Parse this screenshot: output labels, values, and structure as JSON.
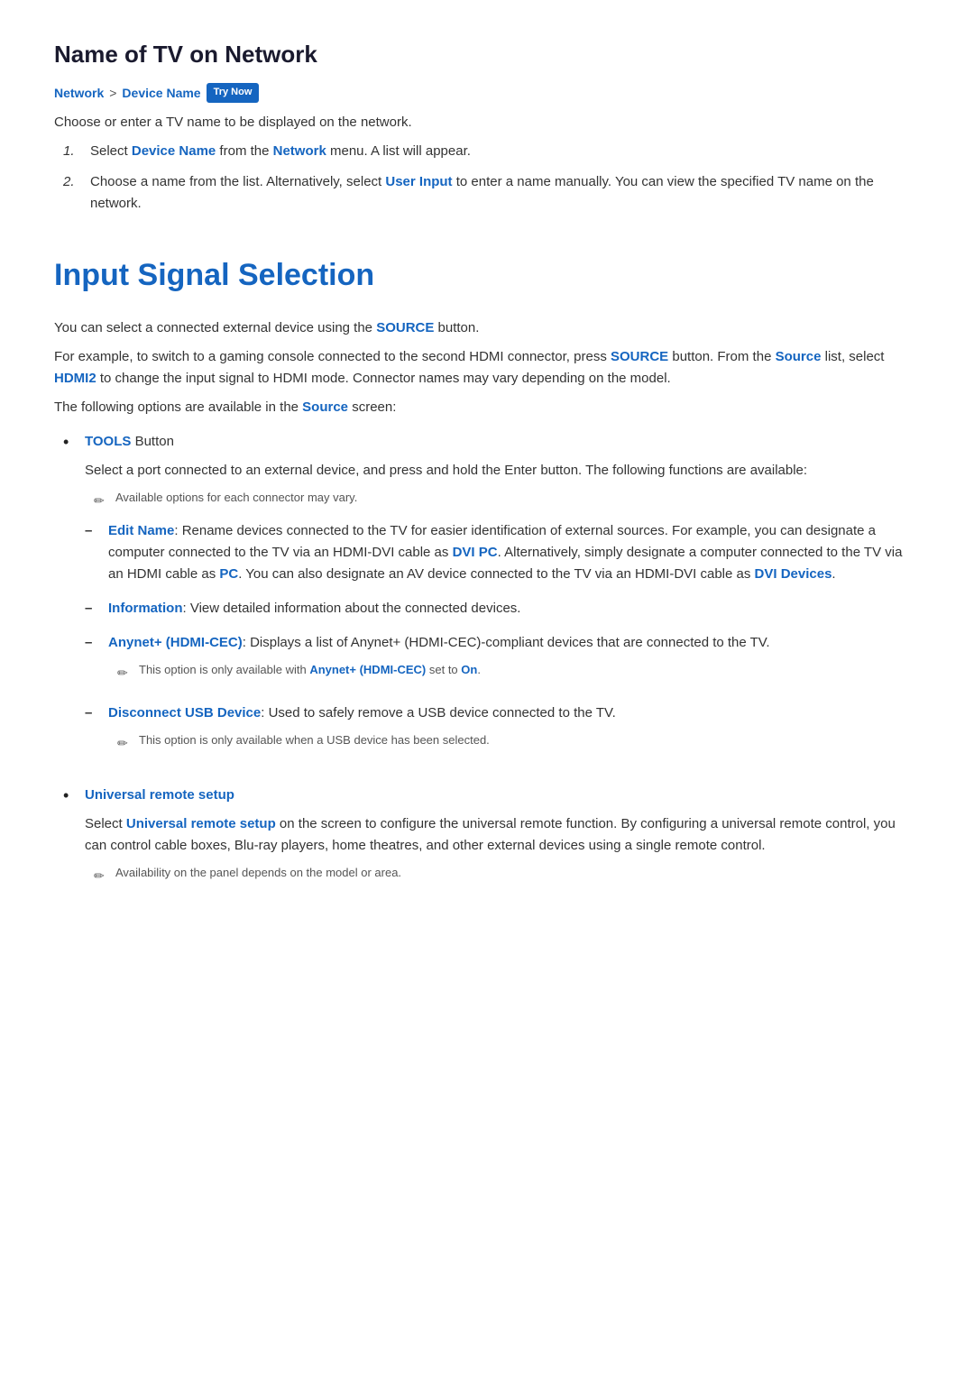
{
  "section1": {
    "title": "Name of TV on Network",
    "breadcrumb": {
      "part1": "Network",
      "separator": ">",
      "part2": "Device Name",
      "badge": "Try Now"
    },
    "intro": "Choose or enter a TV name to be displayed on the network.",
    "steps": [
      {
        "num": "1.",
        "text_before": "Select ",
        "highlight1": "Device Name",
        "text_mid": " from the ",
        "highlight2": "Network",
        "text_after": " menu. A list will appear."
      },
      {
        "num": "2.",
        "text_before": "Choose a name from the list. Alternatively, select ",
        "highlight1": "User Input",
        "text_after": " to enter a name manually. You can view the specified TV name on the network."
      }
    ]
  },
  "section2": {
    "title": "Input Signal Selection",
    "intro1_before": "You can select a connected external device using the ",
    "intro1_highlight": "SOURCE",
    "intro1_after": " button.",
    "intro2_before": "For example, to switch to a gaming console connected to the second HDMI connector, press ",
    "intro2_highlight1": "SOURCE",
    "intro2_mid1": " button. From the ",
    "intro2_highlight2": "Source",
    "intro2_mid2": " list, select ",
    "intro2_highlight3": "HDMI2",
    "intro2_after": " to change the input signal to HDMI mode. Connector names may vary depending on the model.",
    "intro3_before": "The following options are available in the ",
    "intro3_highlight": "Source",
    "intro3_after": " screen:",
    "bullets": [
      {
        "title": "TOOLS",
        "title_after": " Button",
        "description": "Select a port connected to an external device, and press and hold the Enter button. The following functions are available:",
        "note": "Available options for each connector may vary.",
        "sub_items": [
          {
            "title": "Edit Name",
            "title_suffix": ": Rename devices connected to the TV for easier identification of external sources. For example, you can designate a computer connected to the TV via an HDMI-DVI cable as ",
            "highlight1": "DVI PC",
            "mid1": ". Alternatively, simply designate a computer connected to the TV via an HDMI cable as ",
            "highlight2": "PC",
            "mid2": ". You can also designate an AV device connected to the TV via an HDMI-DVI cable as ",
            "highlight3": "DVI Devices",
            "suffix3": "."
          },
          {
            "title": "Information",
            "title_suffix": ": View detailed information about the connected devices."
          },
          {
            "title": "Anynet+ (HDMI-CEC)",
            "title_suffix": ": Displays a list of Anynet+ (HDMI-CEC)-compliant devices that are connected to the TV.",
            "note_before": "This option is only available with ",
            "note_highlight1": "Anynet+ (HDMI-CEC)",
            "note_mid": " set to ",
            "note_highlight2": "On",
            "note_suffix": "."
          },
          {
            "title": "Disconnect USB Device",
            "title_suffix": ": Used to safely remove a USB device connected to the TV.",
            "note": "This option is only available when a USB device has been selected."
          }
        ]
      },
      {
        "title": "Universal remote setup",
        "description_before": "Select ",
        "description_highlight": "Universal remote setup",
        "description_after": " on the screen to configure the universal remote function. By configuring a universal remote control, you can control cable boxes, Blu-ray players, home theatres, and other external devices using a single remote control.",
        "note": "Availability on the panel depends on the model or area."
      }
    ]
  }
}
